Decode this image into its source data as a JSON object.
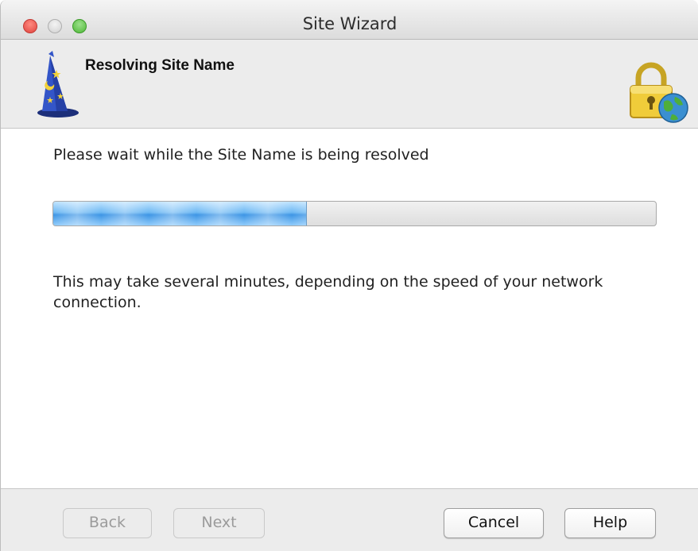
{
  "window": {
    "title": "Site Wizard"
  },
  "header": {
    "title": "Resolving Site Name",
    "left_icon": "wizard-hat-icon",
    "right_icon": "lock-globe-icon"
  },
  "content": {
    "status_text": "Please wait while the Site Name is being resolved",
    "progress_fraction": 0.42,
    "note_text": "This may take several minutes, depending on the speed of your network connection."
  },
  "buttons": {
    "back": {
      "label": "Back",
      "enabled": false
    },
    "next": {
      "label": "Next",
      "enabled": false
    },
    "cancel": {
      "label": "Cancel",
      "enabled": true
    },
    "help": {
      "label": "Help",
      "enabled": true
    }
  },
  "colors": {
    "close": "#e0443e",
    "zoom": "#4fb838",
    "progress": "#3d95e5"
  }
}
